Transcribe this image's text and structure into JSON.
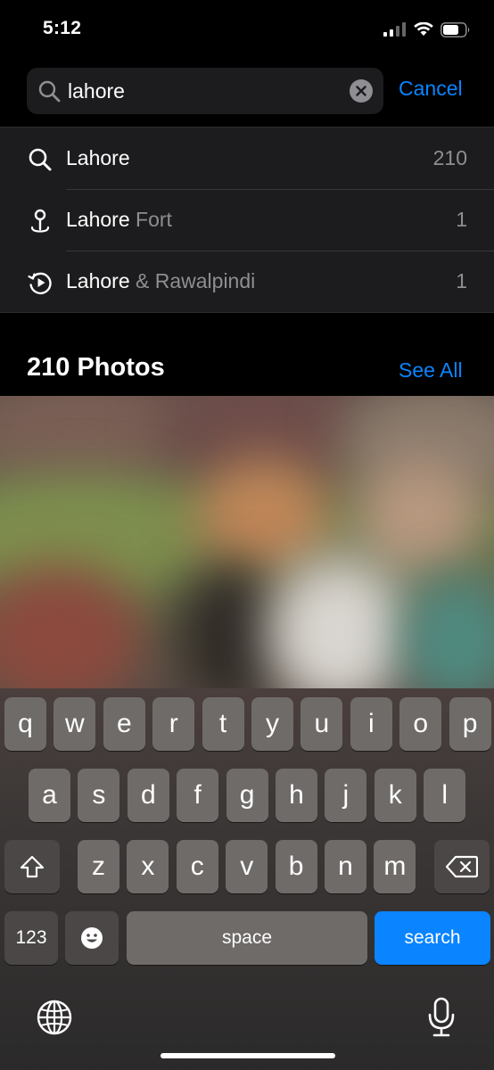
{
  "status_bar": {
    "time": "5:12"
  },
  "search": {
    "query": "lahore",
    "cancel_label": "Cancel"
  },
  "suggestions": [
    {
      "icon": "search-icon",
      "primary": "Lahore",
      "secondary": "",
      "count": "210"
    },
    {
      "icon": "location-pin-icon",
      "primary": "Lahore",
      "secondary": " Fort",
      "count": "1"
    },
    {
      "icon": "memories-play-icon",
      "primary": "Lahore",
      "secondary": " & Rawalpindi",
      "count": "1"
    }
  ],
  "photos_section": {
    "title": "210 Photos",
    "see_all_label": "See All"
  },
  "keyboard": {
    "row1": [
      "q",
      "w",
      "e",
      "r",
      "t",
      "y",
      "u",
      "i",
      "o",
      "p"
    ],
    "row2": [
      "a",
      "s",
      "d",
      "f",
      "g",
      "h",
      "j",
      "k",
      "l"
    ],
    "row3": [
      "z",
      "x",
      "c",
      "v",
      "b",
      "n",
      "m"
    ],
    "numbers_label": "123",
    "space_label": "space",
    "search_label": "search"
  },
  "colors": {
    "accent": "#0a84ff",
    "background": "#000000",
    "row_background": "#1c1c1e",
    "secondary_text": "#8e8e93"
  }
}
